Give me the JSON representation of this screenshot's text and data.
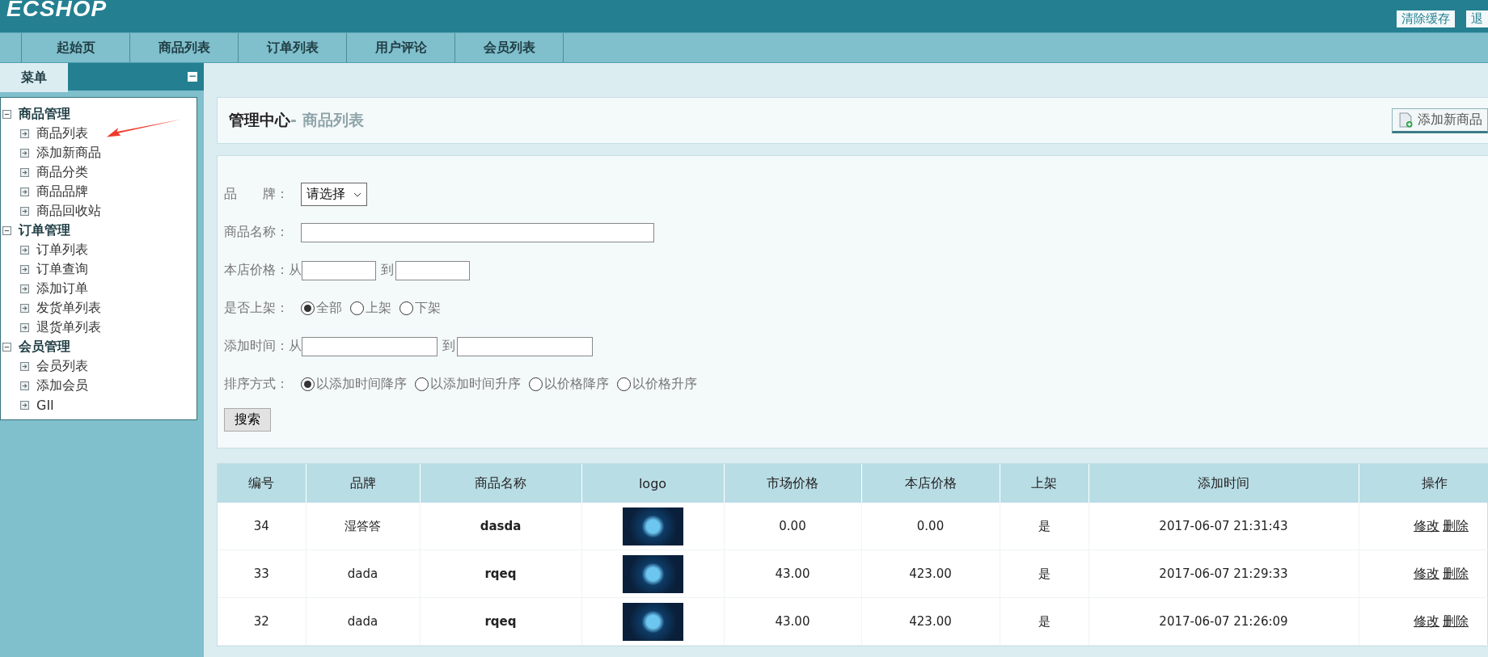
{
  "header": {
    "logo": "ECSHOP",
    "buttons": [
      "清除缓存",
      "退"
    ]
  },
  "nav_tabs": [
    {
      "label": "起始页"
    },
    {
      "label": "商品列表"
    },
    {
      "label": "订单列表"
    },
    {
      "label": "用户评论"
    },
    {
      "label": "会员列表"
    }
  ],
  "sidebar": {
    "title": "菜单",
    "collapse_icon": "−",
    "groups": [
      {
        "label": "商品管理",
        "expanded": true,
        "children": [
          {
            "label": "商品列表"
          },
          {
            "label": "添加新商品"
          },
          {
            "label": "商品分类"
          },
          {
            "label": "商品品牌"
          },
          {
            "label": "商品回收站"
          }
        ]
      },
      {
        "label": "订单管理",
        "expanded": true,
        "children": [
          {
            "label": "订单列表"
          },
          {
            "label": "订单查询"
          },
          {
            "label": "添加订单"
          },
          {
            "label": "发货单列表"
          },
          {
            "label": "退货单列表"
          }
        ]
      },
      {
        "label": "会员管理",
        "expanded": true,
        "children": [
          {
            "label": "会员列表"
          },
          {
            "label": "添加会员"
          },
          {
            "label": "GII"
          }
        ]
      }
    ]
  },
  "page_title": {
    "main": "管理中心",
    "sub": "- 商品列表",
    "action": "添加新商品"
  },
  "filters": [
    {
      "kind": "select",
      "label": "品　　牌：",
      "value": "请选择"
    },
    {
      "kind": "text",
      "label": "商品名称：",
      "wide": true
    },
    {
      "kind": "range",
      "label": "本店价格：从",
      "between": "到",
      "wide": false
    },
    {
      "kind": "radio",
      "label": "是否上架：",
      "options": [
        {
          "label": "全部",
          "selected": true
        },
        {
          "label": "上架",
          "selected": false
        },
        {
          "label": "下架",
          "selected": false
        }
      ]
    },
    {
      "kind": "range",
      "label": "添加时间：从",
      "between": "到",
      "wide": true
    },
    {
      "kind": "radio",
      "label": "排序方式：",
      "options": [
        {
          "label": "以添加时间降序",
          "selected": true
        },
        {
          "label": "以添加时间升序",
          "selected": false
        },
        {
          "label": "以价格降序",
          "selected": false
        },
        {
          "label": "以价格升序",
          "selected": false
        }
      ]
    }
  ],
  "search_button": "搜索",
  "table": {
    "columns": [
      "编号",
      "品牌",
      "商品名称",
      "logo",
      "市场价格",
      "本店价格",
      "上架",
      "添加时间",
      "操作"
    ],
    "rows": [
      {
        "id": "34",
        "brand": "湿答答",
        "name": "dasda",
        "market_price": "0.00",
        "shop_price": "0.00",
        "on_sale": "是",
        "added": "2017-06-07 21:31:43",
        "actions": [
          "修改",
          "删除"
        ]
      },
      {
        "id": "33",
        "brand": "dada",
        "name": "rqeq",
        "market_price": "43.00",
        "shop_price": "423.00",
        "on_sale": "是",
        "added": "2017-06-07 21:29:33",
        "actions": [
          "修改",
          "删除"
        ]
      },
      {
        "id": "32",
        "brand": "dada",
        "name": "rqeq",
        "market_price": "43.00",
        "shop_price": "423.00",
        "on_sale": "是",
        "added": "2017-06-07 21:26:09",
        "actions": [
          "修改",
          "删除"
        ]
      }
    ]
  }
}
